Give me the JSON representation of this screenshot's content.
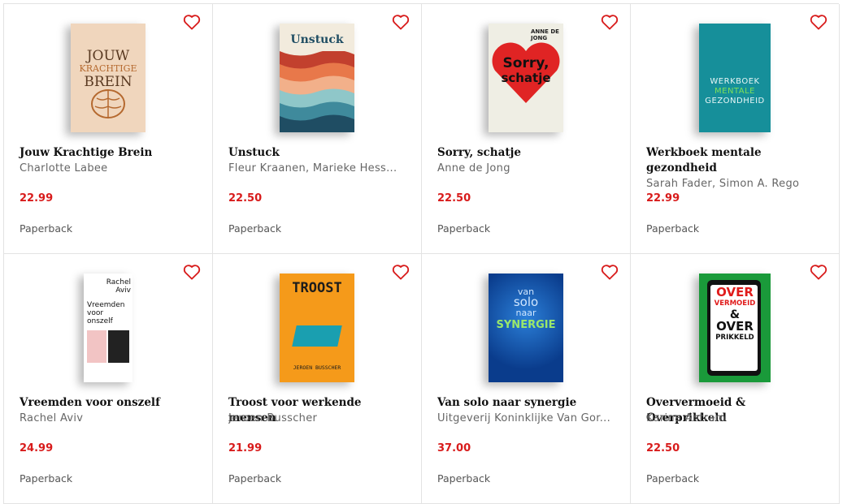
{
  "products": [
    {
      "title": "Jouw Krachtige Brein",
      "author": "Charlotte Labee",
      "price": "22.99",
      "format": "Paperback",
      "cover": {
        "line1": "JOUW",
        "line2": "KRACHTIGE",
        "line3": "BREIN",
        "bg": "#f0d6bd",
        "accent": "#b5692f"
      }
    },
    {
      "title": "Unstuck",
      "author": "Fleur Kraanen, Marieke Hess...",
      "price": "22.50",
      "format": "Paperback",
      "cover": {
        "line1": "Unstuck",
        "bg": "#f2ebdd",
        "accent": "#1f4d63"
      }
    },
    {
      "title": "Sorry, schatje",
      "author": "Anne de Jong",
      "price": "22.50",
      "format": "Paperback",
      "cover": {
        "line1": "Sorry,",
        "line2": "schatje",
        "top": "ANNE DE JONG",
        "bg": "#efeee4",
        "accent": "#e02424"
      }
    },
    {
      "title": "Werkboek mentale gezondheid",
      "author": "Sarah Fader, Simon A. Rego",
      "price": "22.99",
      "format": "Paperback",
      "cover": {
        "line1": "WERKBOEK",
        "line2": "MENTALE",
        "line3": "GEZONDHEID",
        "bg": "#168f9a",
        "accent": "#7ce05a"
      }
    },
    {
      "title": "Vreemden voor onszelf",
      "author": "Rachel Aviv",
      "price": "24.99",
      "format": "Paperback",
      "cover": {
        "line1": "Rachel",
        "line2": "Aviv",
        "line3": "Vreemden voor onszelf",
        "bg": "#ffffff",
        "accent": "#f2c4c4"
      }
    },
    {
      "title": "Troost voor werkende mensen",
      "author": "Jeroen Busscher",
      "price": "21.99",
      "format": "Paperback",
      "cover": {
        "line1": "TROOST",
        "line2": "JEROEN BUSSCHER",
        "bg": "#f59a1a",
        "accent": "#1a9fb0"
      }
    },
    {
      "title": "Van solo naar synergie",
      "author": "Uitgeverij Koninklijke Van Gor...",
      "price": "37.00",
      "format": "Paperback",
      "cover": {
        "line1": "van",
        "line2": "solo",
        "line3": "naar",
        "line4": "SYNERGIE",
        "bg": "#0a3c8c",
        "accent": "#9be86a"
      }
    },
    {
      "title": "Oververmoeid & Overprikkeld",
      "author": "Karina Antram",
      "price": "22.50",
      "format": "Paperback",
      "cover": {
        "line1": "OVER",
        "line2": "VERMOEID",
        "line3": "OVER",
        "line4": "PRIKKELD",
        "bg": "#1a9a3a",
        "accent": "#e01b1b"
      }
    }
  ],
  "icons": {
    "wishlist": "heart-outline-icon"
  },
  "colors": {
    "price": "#d81b1b",
    "heart": "#d81b1b",
    "border": "#e3e3e3"
  }
}
